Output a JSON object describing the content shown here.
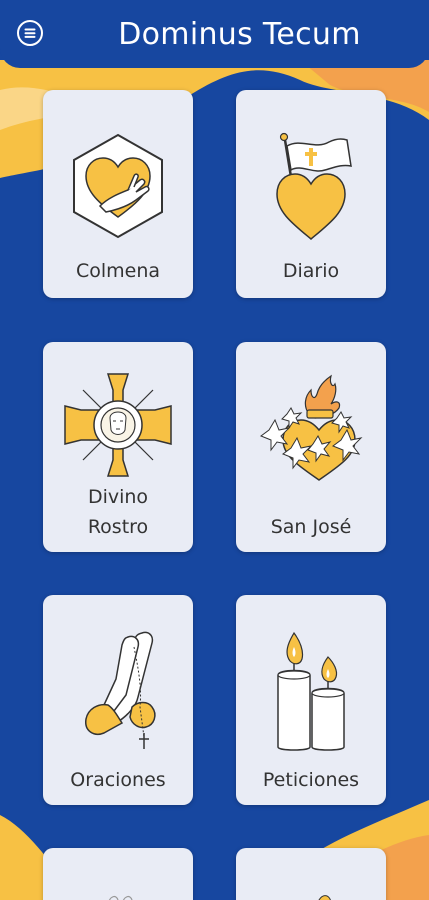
{
  "header": {
    "title": "Dominus Tecum",
    "menu_icon": "hamburger-menu-icon"
  },
  "colors": {
    "primary_blue": "#1747a0",
    "card_bg": "#e9ecf5",
    "accent_yellow": "#f7c144",
    "accent_orange": "#f3a14d"
  },
  "cards": [
    {
      "label": "Colmena",
      "icon": "heart-hand-hexagon-icon"
    },
    {
      "label": "Diario",
      "icon": "heart-flag-icon"
    },
    {
      "label": "Divino Rostro",
      "label_lines": [
        "Divino",
        "Rostro"
      ],
      "icon": "holy-face-cross-icon"
    },
    {
      "label": "San José",
      "icon": "sacred-heart-lilies-icon"
    },
    {
      "label": "Oraciones",
      "icon": "praying-hands-rosary-icon"
    },
    {
      "label": "Peticiones",
      "icon": "candles-icon"
    }
  ]
}
